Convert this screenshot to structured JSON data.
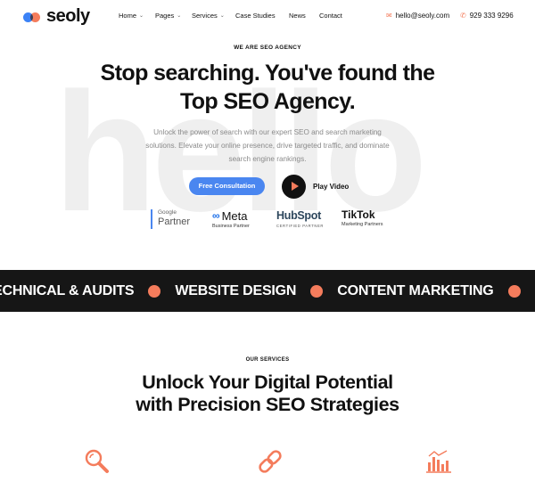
{
  "brand": {
    "name": "seoly",
    "colors": {
      "blue": "#4a86f0",
      "coral": "#f47c5c",
      "dark": "#161616"
    }
  },
  "nav": {
    "home": "Home",
    "pages": "Pages",
    "services": "Services",
    "case_studies": "Case Studies",
    "news": "News",
    "contact": "Contact"
  },
  "contact": {
    "email": "hello@seoly.com",
    "phone": "929 333 9296"
  },
  "hero": {
    "bg_word": "hello",
    "eyebrow": "WE ARE SEO AGENCY",
    "title": "Stop searching. You've found the Top SEO Agency.",
    "description": "Unlock the power of search with our expert SEO and search marketing solutions. Elevate your online presence, drive targeted traffic, and dominate search engine rankings.",
    "cta": "Free Consultation",
    "play_label": "Play Video"
  },
  "partners": {
    "google": {
      "line1": "Google",
      "line2": "Partner"
    },
    "meta": {
      "name": "Meta",
      "sub": "Business Partner"
    },
    "hubspot": {
      "name": "HubSpot",
      "sub": "CERTIFIED PARTNER"
    },
    "tiktok": {
      "name": "TikTok",
      "sub": "Marketing Partners"
    }
  },
  "band": {
    "items": [
      "ECHNICAL & AUDITS",
      "WEBSITE DESIGN",
      "CONTENT MARKETING"
    ]
  },
  "services": {
    "eyebrow": "OUR SERVICES",
    "title": "Unlock Your Digital Potential with Precision SEO Strategies",
    "icons": [
      "search-icon",
      "link-icon",
      "bar-chart-icon"
    ]
  }
}
